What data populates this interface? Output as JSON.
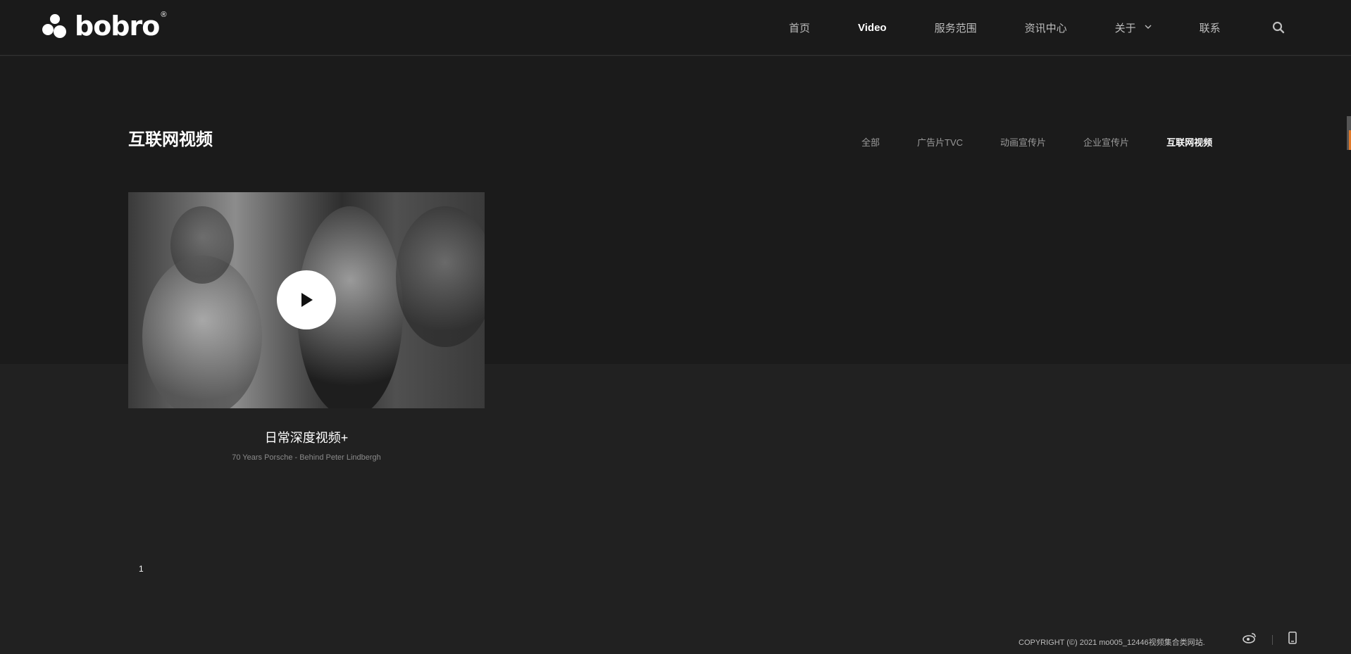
{
  "brand": {
    "name": "bobro",
    "reg": "®"
  },
  "nav": {
    "items": [
      {
        "label": "首页"
      },
      {
        "label": "Video"
      },
      {
        "label": "服务范围"
      },
      {
        "label": "资讯中心"
      },
      {
        "label": "关于"
      },
      {
        "label": "联系"
      }
    ],
    "active": "Video"
  },
  "page": {
    "title": "互联网视频"
  },
  "filters": [
    "全部",
    "广告片TVC",
    "动画宣传片",
    "企业宣传片",
    "互联网视频"
  ],
  "active_filter": "互联网视频",
  "card": {
    "title": "日常深度视频+",
    "subtitle": "70 Years Porsche - Behind Peter Lindbergh"
  },
  "pagination": {
    "current": "1"
  },
  "footer": {
    "copyright": "COPYRIGHT (©) 2021 mo005_12446视频集合类网站."
  },
  "icons": {
    "search": "search-icon",
    "play": "play-icon",
    "weibo": "weibo-icon",
    "mobile": "mobile-icon",
    "chevron": "chevron-down-icon"
  },
  "colors": {
    "background": "#212121",
    "header": "#1a1a1a",
    "accent": "#e07a2a"
  }
}
